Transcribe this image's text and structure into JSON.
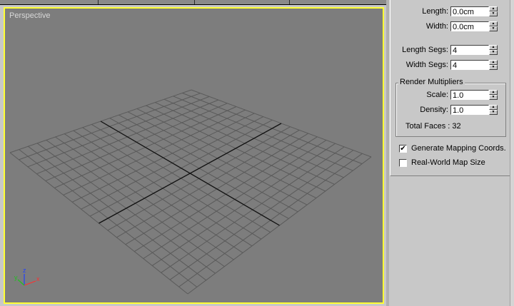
{
  "viewport": {
    "label": "Perspective",
    "axes": {
      "x": "x",
      "y": "y",
      "z": "z"
    }
  },
  "params": {
    "length": {
      "label": "Length:",
      "value": "0.0cm"
    },
    "width": {
      "label": "Width:",
      "value": "0.0cm"
    },
    "length_segs": {
      "label": "Length Segs:",
      "value": "4"
    },
    "width_segs": {
      "label": "Width Segs:",
      "value": "4"
    }
  },
  "render_multipliers": {
    "title": "Render Multipliers",
    "scale": {
      "label": "Scale:",
      "value": "1.0"
    },
    "density": {
      "label": "Density:",
      "value": "1.0"
    },
    "total_faces": "Total Faces : 32"
  },
  "options": {
    "generate_mapping": {
      "label": "Generate Mapping Coords.",
      "checked": "✔"
    },
    "real_world": {
      "label": "Real-World Map Size",
      "checked": ""
    }
  },
  "colors": {
    "viewport_border": "#ffff33",
    "viewport_bg": "#7d7d7d",
    "grid": "#5a5a5a"
  }
}
